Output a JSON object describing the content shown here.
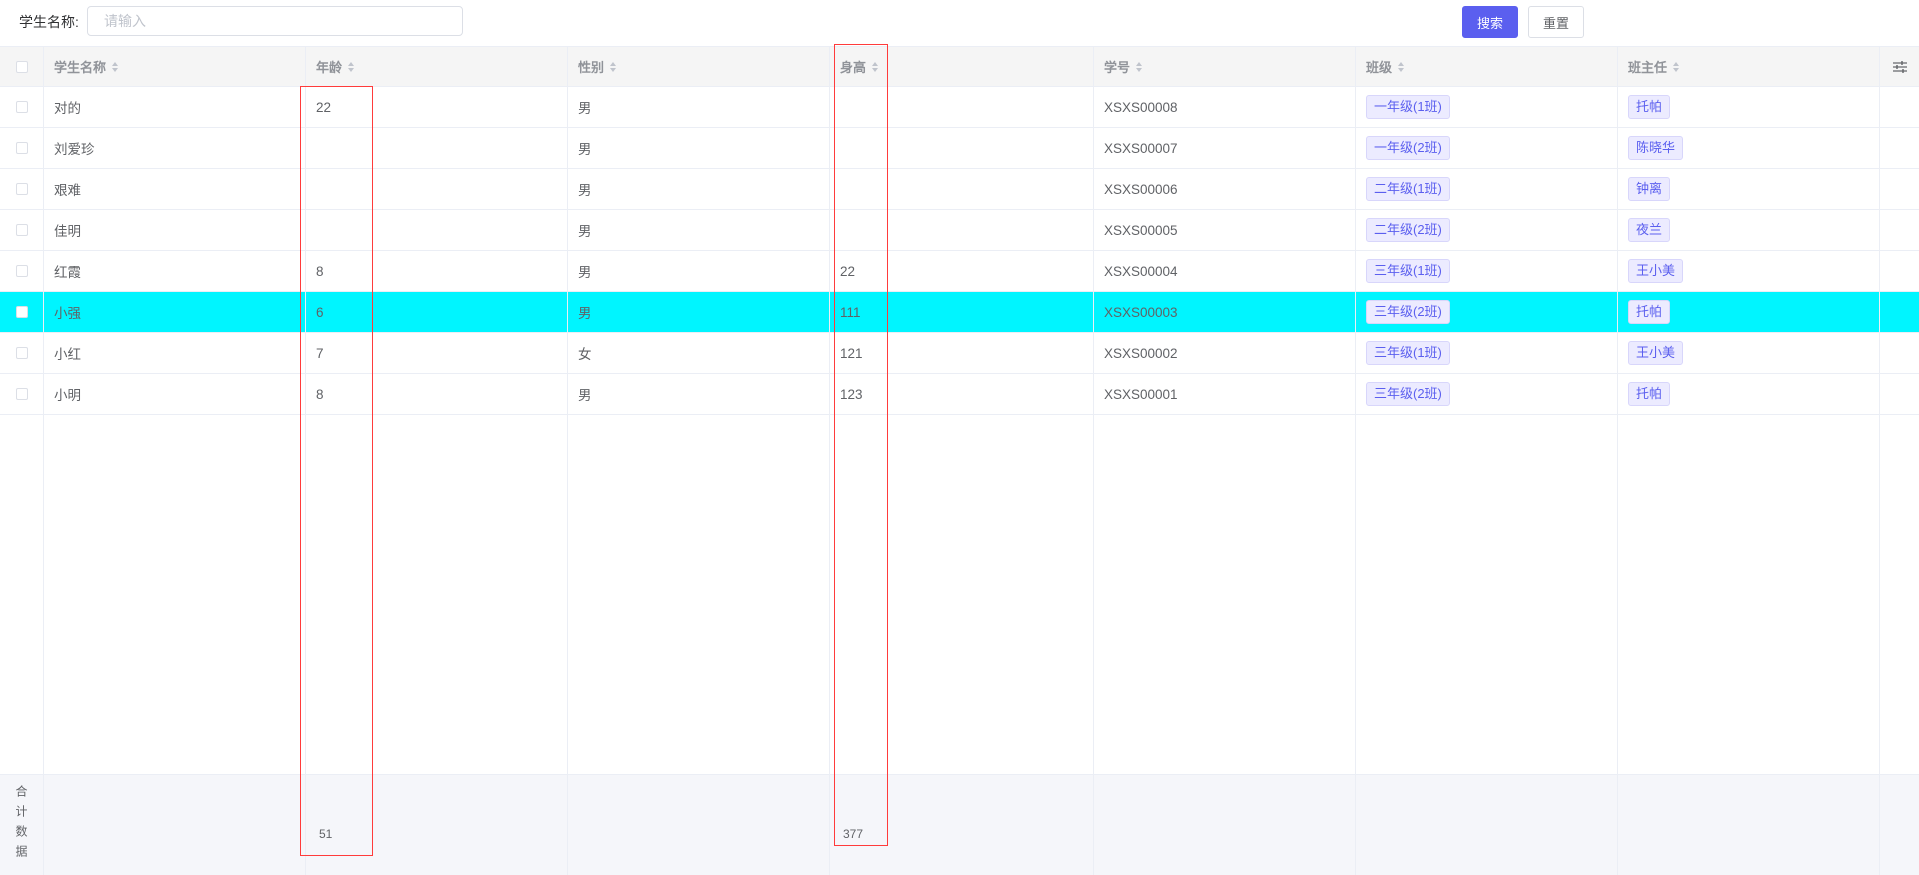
{
  "search": {
    "label": "学生名称:",
    "placeholder": "请输入",
    "search_button": "搜索",
    "reset_button": "重置"
  },
  "columns": [
    "学生名称",
    "年龄",
    "性别",
    "身高",
    "学号",
    "班级",
    "班主任"
  ],
  "rows": [
    {
      "name": "对的",
      "age": "22",
      "sex": "男",
      "height": "",
      "no": "XSXS00008",
      "class": "一年级(1班)",
      "teacher": "托帕"
    },
    {
      "name": "刘爱珍",
      "age": "",
      "sex": "男",
      "height": "",
      "no": "XSXS00007",
      "class": "一年级(2班)",
      "teacher": "陈晓华"
    },
    {
      "name": "艰难",
      "age": "",
      "sex": "男",
      "height": "",
      "no": "XSXS00006",
      "class": "二年级(1班)",
      "teacher": "钟离"
    },
    {
      "name": "佳明",
      "age": "",
      "sex": "男",
      "height": "",
      "no": "XSXS00005",
      "class": "二年级(2班)",
      "teacher": "夜兰"
    },
    {
      "name": "红霞",
      "age": "8",
      "sex": "男",
      "height": "22",
      "no": "XSXS00004",
      "class": "三年级(1班)",
      "teacher": "王小美"
    },
    {
      "name": "小强",
      "age": "6",
      "sex": "男",
      "height": "111",
      "no": "XSXS00003",
      "class": "三年级(2班)",
      "teacher": "托帕"
    },
    {
      "name": "小红",
      "age": "7",
      "sex": "女",
      "height": "121",
      "no": "XSXS00002",
      "class": "三年级(1班)",
      "teacher": "王小美"
    },
    {
      "name": "小明",
      "age": "8",
      "sex": "男",
      "height": "123",
      "no": "XSXS00001",
      "class": "三年级(2班)",
      "teacher": "托帕"
    }
  ],
  "highlight_row": 5,
  "highlight_color": "#00f5ff",
  "accent_color": "#5b5fef",
  "summary": {
    "label": "合计数据",
    "age_total": "51",
    "height_total": "377"
  },
  "icons": {
    "column_settings": "sliders-icon"
  }
}
